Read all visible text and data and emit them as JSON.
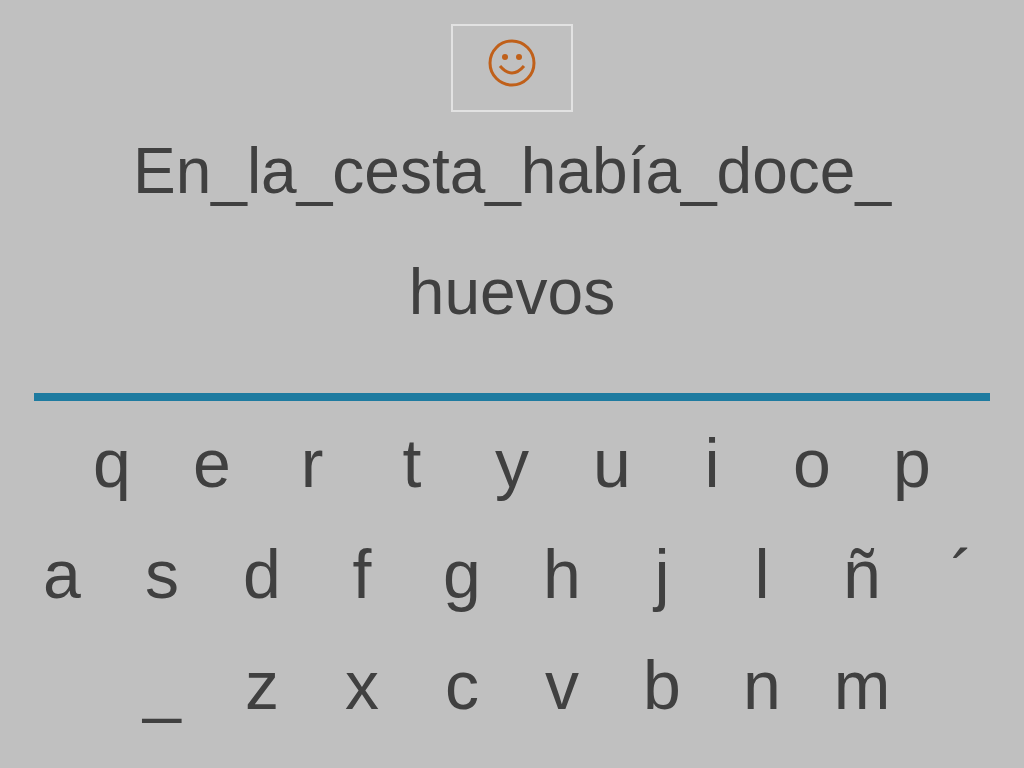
{
  "feedback": {
    "kind": "happy"
  },
  "sentence_lines": [
    "En_la_cesta_había_doce_",
    "huevos"
  ],
  "keyboard": {
    "rows": [
      [
        "q",
        "e",
        "r",
        "t",
        "y",
        "u",
        "i",
        "o",
        "p"
      ],
      [
        "a",
        "s",
        "d",
        "f",
        "g",
        "h",
        "j",
        "l",
        "ñ",
        "´"
      ],
      [
        "_",
        "z",
        "x",
        "c",
        "v",
        "b",
        "n",
        "m"
      ]
    ]
  }
}
